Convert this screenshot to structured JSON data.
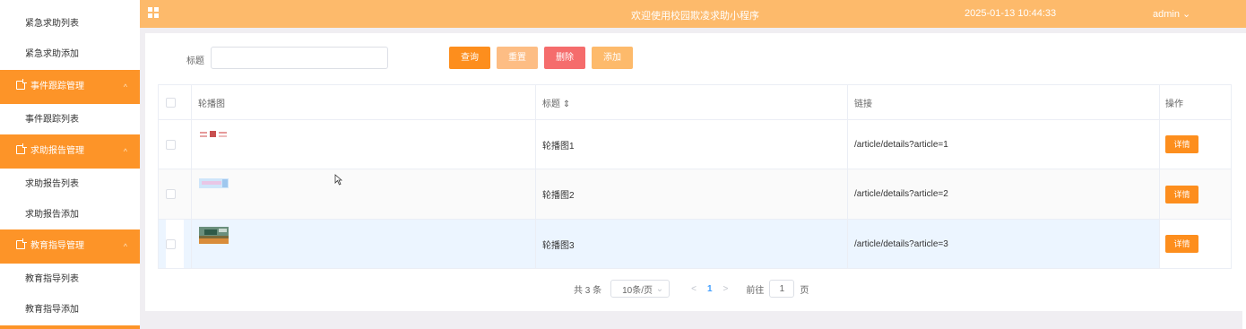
{
  "sidebar": {
    "items": [
      {
        "type": "sub",
        "label": "紧急求助列表"
      },
      {
        "type": "sub",
        "label": "紧急求助添加"
      },
      {
        "type": "group",
        "label": "事件跟踪管理",
        "chevron": "^"
      },
      {
        "type": "sub",
        "label": "事件跟踪列表"
      },
      {
        "type": "group",
        "label": "求助报告管理",
        "chevron": "^"
      },
      {
        "type": "sub",
        "label": "求助报告列表"
      },
      {
        "type": "sub",
        "label": "求助报告添加"
      },
      {
        "type": "group",
        "label": "教育指导管理",
        "chevron": "^"
      },
      {
        "type": "sub",
        "label": "教育指导列表"
      },
      {
        "type": "sub",
        "label": "教育指导添加"
      }
    ]
  },
  "header": {
    "welcome": "欢迎使用校园欺凌求助小程序",
    "datetime": "2025-01-13 10:44:33",
    "user": "admin ⌄",
    "menu_icon": "grid-icon"
  },
  "search": {
    "label": "标题",
    "value": "",
    "placeholder": "",
    "buttons": {
      "query": "查询",
      "reset": "重置",
      "delete": "删除",
      "add": "添加"
    }
  },
  "table": {
    "headers": {
      "image": "轮播图",
      "title": "标题 ⇕",
      "link": "链接",
      "action": "操作"
    },
    "rows": [
      {
        "image_icon": "banner-thumbnail-1",
        "title": "轮播图1",
        "link": "/article/details?article=1",
        "action": "详情"
      },
      {
        "image_icon": "banner-thumbnail-2",
        "title": "轮播图2",
        "link": "/article/details?article=2",
        "action": "详情"
      },
      {
        "image_icon": "banner-thumbnail-3",
        "title": "轮播图3",
        "link": "/article/details?article=3",
        "action": "详情"
      }
    ]
  },
  "pagination": {
    "total": "共 3 条",
    "page_size": "10条/页",
    "page_size_chevron": "⌄",
    "prev": "<",
    "current": "1",
    "next": ">",
    "goto_label": "前往",
    "goto_value": "1",
    "goto_suffix": "页"
  },
  "colors": {
    "accent": "#fd9428",
    "topbar": "#fdba6b",
    "query": "#fd8e1d",
    "reset": "#fdbd84",
    "delete": "#f56c6c",
    "add": "#fdba6b",
    "hover_row": "#ecf5ff"
  }
}
